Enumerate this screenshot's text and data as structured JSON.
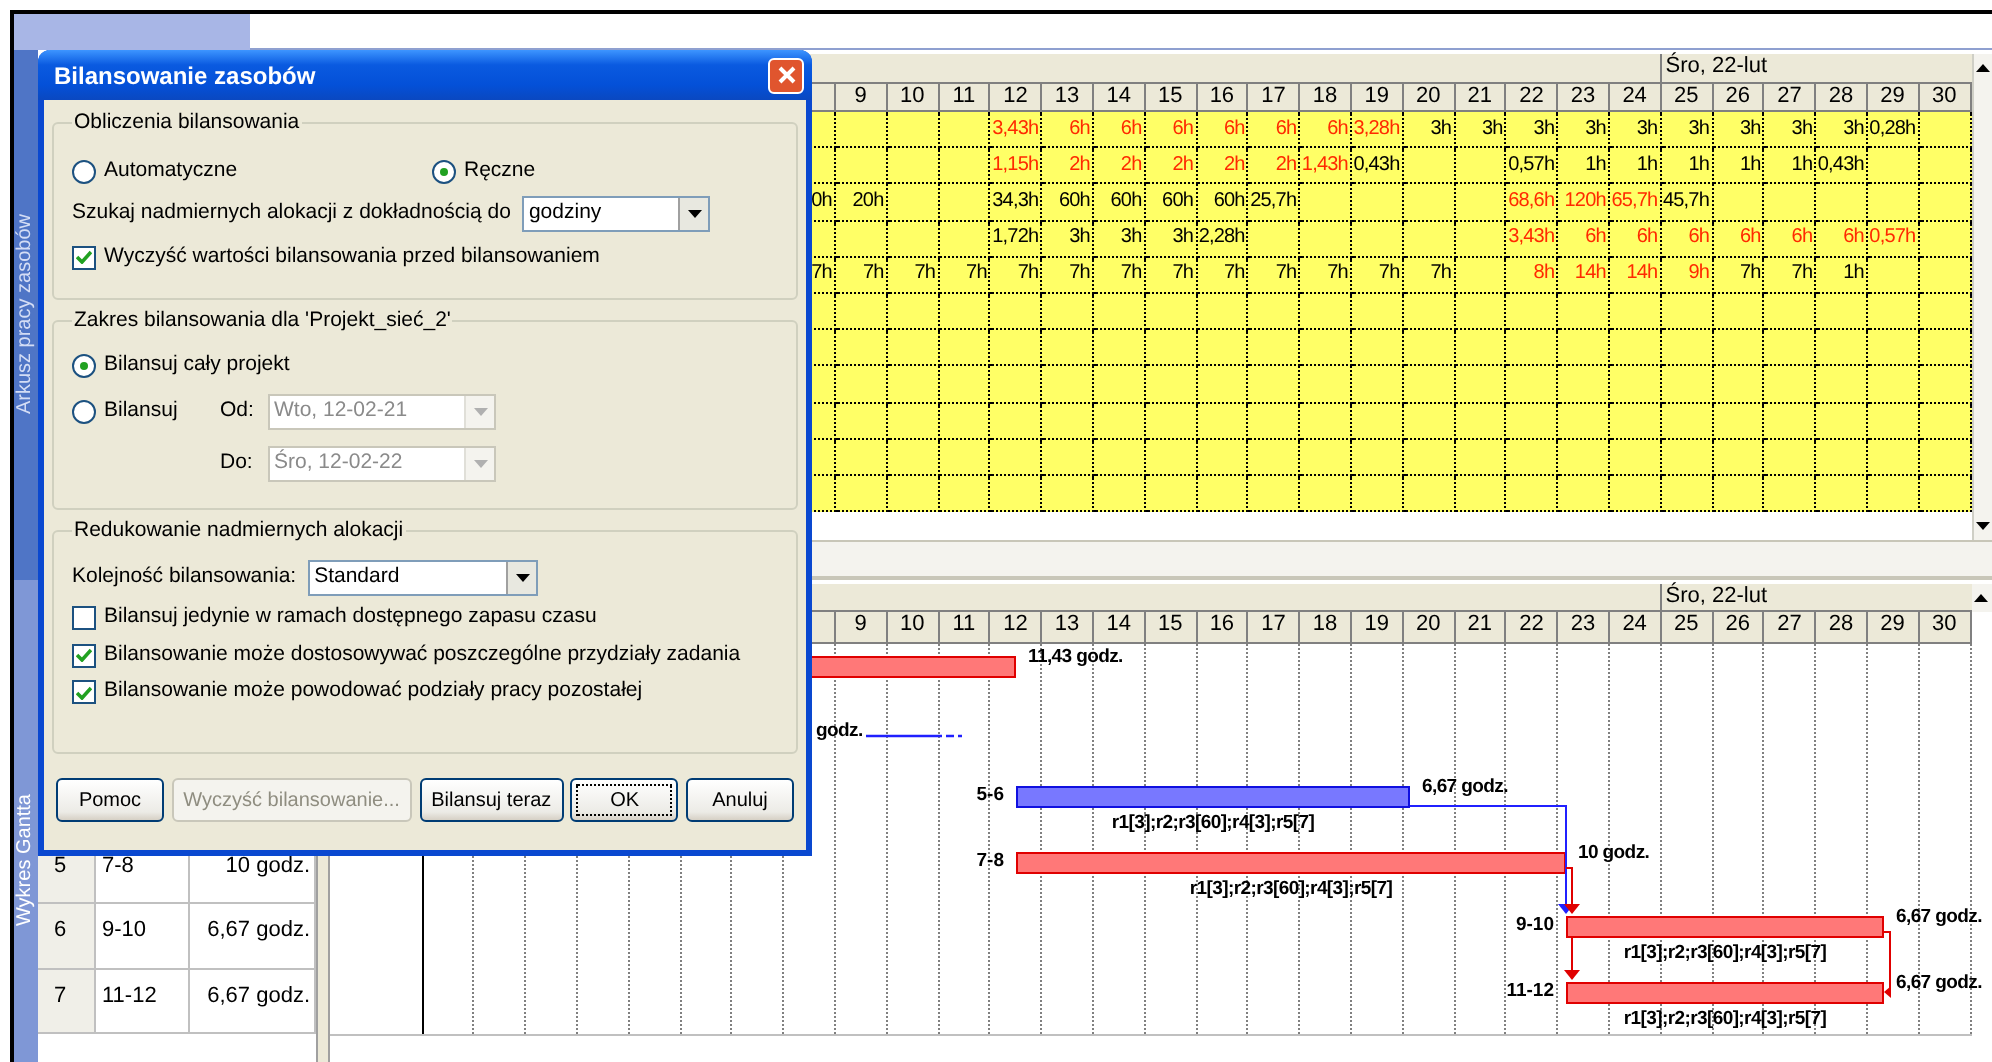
{
  "views": {
    "upper": "Arkusz pracy zasobów",
    "lower": "Wykres Gantta"
  },
  "resource_usage": {
    "week_label": "Śro, 22-lut",
    "days": [
      "9",
      "10",
      "11",
      "12",
      "13",
      "14",
      "15",
      "16",
      "17",
      "18",
      "19",
      "20",
      "21",
      "22",
      "23",
      "24",
      "25",
      "26",
      "27",
      "28",
      "29",
      "30"
    ],
    "rows": [
      {
        "cells": [
          null,
          null,
          null,
          {
            "value": "3,43h",
            "overallocated": true
          },
          {
            "value": "6h",
            "overallocated": true
          },
          {
            "value": "6h",
            "overallocated": true
          },
          {
            "value": "6h",
            "overallocated": true
          },
          {
            "value": "6h",
            "overallocated": true
          },
          {
            "value": "6h",
            "overallocated": true
          },
          {
            "value": "6h",
            "overallocated": true
          },
          {
            "value": "3,28h",
            "overallocated": true
          },
          {
            "value": "3h",
            "overallocated": false
          },
          {
            "value": "3h",
            "overallocated": false
          },
          {
            "value": "3h",
            "overallocated": false
          },
          {
            "value": "3h",
            "overallocated": false
          },
          {
            "value": "3h",
            "overallocated": false
          },
          {
            "value": "3h",
            "overallocated": false
          },
          {
            "value": "3h",
            "overallocated": false
          },
          {
            "value": "3h",
            "overallocated": false
          },
          {
            "value": "3h",
            "overallocated": false
          },
          {
            "value": "0,28h",
            "overallocated": false
          },
          null
        ]
      },
      {
        "cells": [
          null,
          null,
          null,
          {
            "value": "1,15h",
            "overallocated": true
          },
          {
            "value": "2h",
            "overallocated": true
          },
          {
            "value": "2h",
            "overallocated": true
          },
          {
            "value": "2h",
            "overallocated": true
          },
          {
            "value": "2h",
            "overallocated": true
          },
          {
            "value": "2h",
            "overallocated": true
          },
          {
            "value": "1,43h",
            "overallocated": true
          },
          {
            "value": "0,43h",
            "overallocated": false
          },
          null,
          null,
          {
            "value": "0,57h",
            "overallocated": false
          },
          {
            "value": "1h",
            "overallocated": false
          },
          {
            "value": "1h",
            "overallocated": false
          },
          {
            "value": "1h",
            "overallocated": false
          },
          {
            "value": "1h",
            "overallocated": false
          },
          {
            "value": "1h",
            "overallocated": false
          },
          {
            "value": "0,43h",
            "overallocated": false
          },
          null,
          null
        ]
      },
      {
        "partial": "0h",
        "cells": [
          {
            "value": "20h",
            "overallocated": false
          },
          null,
          null,
          {
            "value": "34,3h",
            "overallocated": false
          },
          {
            "value": "60h",
            "overallocated": false
          },
          {
            "value": "60h",
            "overallocated": false
          },
          {
            "value": "60h",
            "overallocated": false
          },
          {
            "value": "60h",
            "overallocated": false
          },
          {
            "value": "25,7h",
            "overallocated": false
          },
          null,
          null,
          null,
          null,
          {
            "value": "68,6h",
            "overallocated": true
          },
          {
            "value": "120h",
            "overallocated": true
          },
          {
            "value": "65,7h",
            "overallocated": true
          },
          {
            "value": "45,7h",
            "overallocated": false
          },
          null,
          null,
          null,
          null,
          null
        ]
      },
      {
        "cells": [
          null,
          null,
          null,
          {
            "value": "1,72h",
            "overallocated": false
          },
          {
            "value": "3h",
            "overallocated": false
          },
          {
            "value": "3h",
            "overallocated": false
          },
          {
            "value": "3h",
            "overallocated": false
          },
          {
            "value": "2,28h",
            "overallocated": false
          },
          null,
          null,
          null,
          null,
          null,
          {
            "value": "3,43h",
            "overallocated": true
          },
          {
            "value": "6h",
            "overallocated": true
          },
          {
            "value": "6h",
            "overallocated": true
          },
          {
            "value": "6h",
            "overallocated": true
          },
          {
            "value": "6h",
            "overallocated": true
          },
          {
            "value": "6h",
            "overallocated": true
          },
          {
            "value": "6h",
            "overallocated": true
          },
          {
            "value": "0,57h",
            "overallocated": true
          },
          null
        ]
      },
      {
        "partial": "7h",
        "cells": [
          {
            "value": "7h",
            "overallocated": false
          },
          {
            "value": "7h",
            "overallocated": false
          },
          {
            "value": "7h",
            "overallocated": false
          },
          {
            "value": "7h",
            "overallocated": false
          },
          {
            "value": "7h",
            "overallocated": false
          },
          {
            "value": "7h",
            "overallocated": false
          },
          {
            "value": "7h",
            "overallocated": false
          },
          {
            "value": "7h",
            "overallocated": false
          },
          {
            "value": "7h",
            "overallocated": false
          },
          {
            "value": "7h",
            "overallocated": false
          },
          {
            "value": "7h",
            "overallocated": false
          },
          {
            "value": "7h",
            "overallocated": false
          },
          null,
          {
            "value": "8h",
            "overallocated": true
          },
          {
            "value": "14h",
            "overallocated": true
          },
          {
            "value": "14h",
            "overallocated": true
          },
          {
            "value": "9h",
            "overallocated": true
          },
          {
            "value": "7h",
            "overallocated": false
          },
          {
            "value": "7h",
            "overallocated": false
          },
          {
            "value": "1h",
            "overallocated": false
          },
          null,
          null
        ]
      }
    ]
  },
  "gantt": {
    "week_label": "Śro, 22-lut",
    "days": [
      "9",
      "10",
      "11",
      "12",
      "13",
      "14",
      "15",
      "16",
      "17",
      "18",
      "19",
      "20",
      "21",
      "22",
      "23",
      "24",
      "25",
      "26",
      "27",
      "28",
      "29",
      "30"
    ],
    "table_rows": [
      {
        "id": "5",
        "name": "7-8",
        "duration": "10 godz."
      },
      {
        "id": "6",
        "name": "9-10",
        "duration": "6,67 godz."
      },
      {
        "id": "7",
        "name": "11-12",
        "duration": "6,67 godz."
      }
    ],
    "tasks": [
      {
        "kind": "bar",
        "critical": true,
        "duration": "11,43 godz."
      },
      {
        "kind": "line",
        "critical": false,
        "duration": "godz."
      },
      {
        "kind": "bar",
        "critical": false,
        "label": "5-6",
        "duration": "6,67 godz.",
        "resources": "r1[3];r2;r3[60];r4[3];r5[7]"
      },
      {
        "kind": "bar",
        "critical": true,
        "label": "7-8",
        "duration": "10 godz.",
        "resources": "r1[3];r2;r3[60];r4[3];r5[7]"
      },
      {
        "kind": "bar",
        "critical": true,
        "label": "9-10",
        "duration": "6,67 godz.",
        "resources": "r1[3];r2;r3[60];r4[3];r5[7]"
      },
      {
        "kind": "bar",
        "critical": true,
        "label": "11-12",
        "duration": "6,67 godz.",
        "resources": "r1[3];r2;r3[60];r4[3];r5[7]"
      }
    ]
  },
  "dialog": {
    "title": "Bilansowanie zasobów",
    "calculation": {
      "title": "Obliczenia bilansowania",
      "modes": [
        {
          "label": "Automatyczne",
          "selected": false
        },
        {
          "label": "Ręczne",
          "selected": true
        }
      ],
      "search_label": "Szukaj nadmiernych alokacji z dokładnością do",
      "search_value": "godziny",
      "clear_option": {
        "label": "Wyczyść wartości bilansowania przed bilansowaniem",
        "checked": true
      }
    },
    "range": {
      "title": "Zakres bilansowania dla 'Projekt_sieć_2'",
      "options": [
        {
          "label": "Bilansuj cały projekt",
          "selected": true
        },
        {
          "label": "Bilansuj",
          "selected": false
        }
      ],
      "from": {
        "label": "Od:",
        "value": "Wto, 12-02-21",
        "disabled": true
      },
      "to": {
        "label": "Do:",
        "value": "Śro, 12-02-22",
        "disabled": true
      }
    },
    "reduction": {
      "title": "Redukowanie nadmiernych alokacji",
      "order_label": "Kolejność bilansowania:",
      "order_value": "Standard",
      "options": [
        {
          "label": "Bilansuj jedynie w ramach dostępnego zapasu czasu",
          "checked": false
        },
        {
          "label": "Bilansowanie może dostosowywać poszczególne przydziały zadania",
          "checked": true
        },
        {
          "label": "Bilansowanie może powodować podziały pracy pozostałej",
          "checked": true
        }
      ]
    },
    "buttons": [
      {
        "label": "Pomoc",
        "disabled": false,
        "focused": false
      },
      {
        "label": "Wyczyść bilansowanie...",
        "disabled": true,
        "focused": false
      },
      {
        "label": "Bilansuj teraz",
        "disabled": false,
        "focused": false
      },
      {
        "label": "OK",
        "disabled": false,
        "focused": true
      },
      {
        "label": "Anuluj",
        "disabled": false,
        "focused": false
      }
    ]
  }
}
